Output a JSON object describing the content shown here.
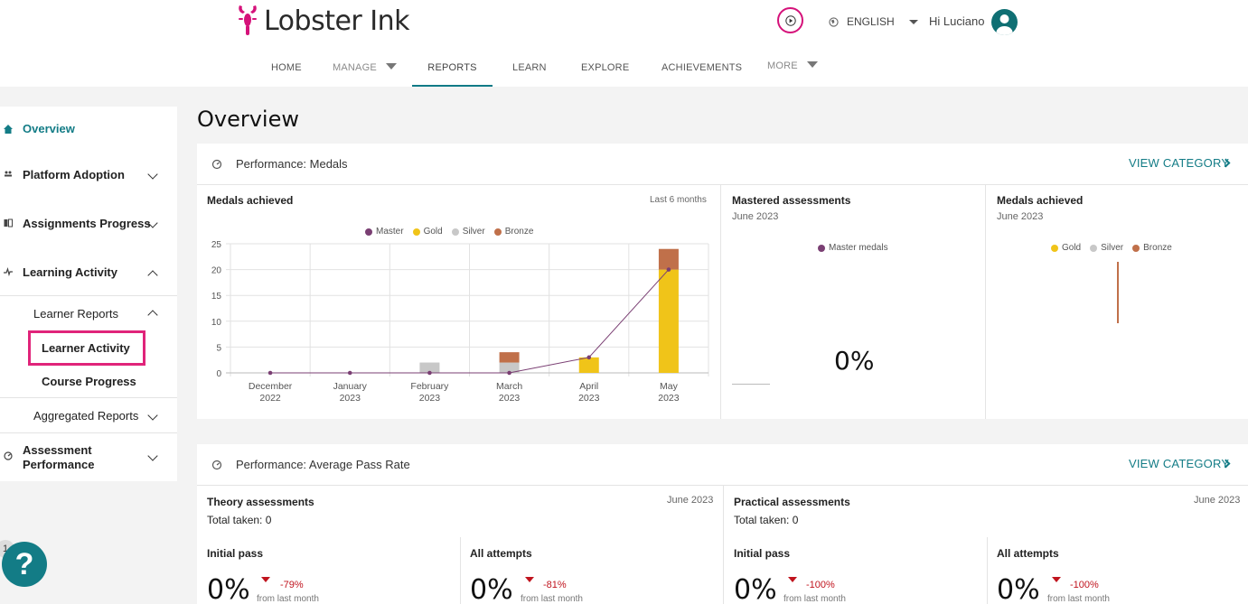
{
  "header": {
    "logo_text": "Lobster Ink",
    "language": "ENGLISH",
    "greeting": "Hi Luciano"
  },
  "nav": [
    {
      "label": "HOME"
    },
    {
      "label": "MANAGE"
    },
    {
      "label": "REPORTS"
    },
    {
      "label": "LEARN"
    },
    {
      "label": "EXPLORE"
    },
    {
      "label": "ACHIEVEMENTS"
    },
    {
      "label": "MORE"
    }
  ],
  "sidebar": {
    "items": [
      {
        "label": "Overview"
      },
      {
        "label": "Platform Adoption"
      },
      {
        "label": "Assignments Progress"
      },
      {
        "label": "Learning Activity"
      },
      {
        "label": "Learner Reports"
      },
      {
        "label": "Learner Activity"
      },
      {
        "label": "Course Progress"
      },
      {
        "label": "Aggregated Reports"
      },
      {
        "label": "Assessment"
      },
      {
        "label": "Performance"
      }
    ]
  },
  "help": {
    "label": "?",
    "badge": "1"
  },
  "page": {
    "title": "Overview"
  },
  "medals_card": {
    "title": "Performance: Medals",
    "view_category": "VIEW CATEGORY",
    "chart_panel": {
      "title": "Medals achieved",
      "range": "Last 6 months"
    },
    "mastered": {
      "title": "Mastered assessments",
      "date": "June 2023",
      "legend": "Master medals",
      "value": "0%"
    },
    "medals_june": {
      "title": "Medals achieved",
      "date": "June 2023",
      "legend": [
        "Gold",
        "Silver",
        "Bronze"
      ]
    }
  },
  "chart_data": {
    "type": "bar",
    "categories": [
      "December 2022",
      "January 2023",
      "February 2023",
      "March 2023",
      "April 2023",
      "May 2023"
    ],
    "category_lines": [
      [
        "December",
        "2022"
      ],
      [
        "January",
        "2023"
      ],
      [
        "February",
        "2023"
      ],
      [
        "March",
        "2023"
      ],
      [
        "April",
        "2023"
      ],
      [
        "May",
        "2023"
      ]
    ],
    "series": [
      {
        "name": "Master",
        "kind": "line",
        "color": "#7a3f73",
        "values": [
          0,
          0,
          0,
          0,
          3,
          20
        ]
      },
      {
        "name": "Gold",
        "kind": "bar",
        "color": "#f0c419",
        "values": [
          0,
          0,
          0,
          0,
          3,
          20
        ]
      },
      {
        "name": "Silver",
        "kind": "bar",
        "color": "#c8c8c8",
        "values": [
          0,
          0,
          2,
          2,
          0,
          0
        ]
      },
      {
        "name": "Bronze",
        "kind": "bar",
        "color": "#c0704a",
        "values": [
          0,
          0,
          0,
          2,
          0,
          4
        ]
      }
    ],
    "ylim": [
      0,
      25
    ],
    "yticks": [
      0,
      5,
      10,
      15,
      20,
      25
    ],
    "grid": true,
    "legend_position": "top"
  },
  "pass_card": {
    "title": "Performance: Average Pass Rate",
    "view_category": "VIEW CATEGORY",
    "theory": {
      "title": "Theory assessments",
      "date": "June 2023",
      "total": "Total taken: 0",
      "initial": {
        "label": "Initial pass",
        "value": "0%",
        "delta": "-79%",
        "from": "from last month"
      },
      "all": {
        "label": "All attempts",
        "value": "0%",
        "delta": "-81%",
        "from": "from last month"
      }
    },
    "practical": {
      "title": "Practical assessments",
      "date": "June 2023",
      "total": "Total taken: 0",
      "initial": {
        "label": "Initial pass",
        "value": "0%",
        "delta": "-100%",
        "from": "from last month"
      },
      "all": {
        "label": "All attempts",
        "value": "0%",
        "delta": "-100%",
        "from": "from last month"
      }
    }
  },
  "colors": {
    "accent": "#137c86",
    "brand": "#d5127a",
    "negative": "#c0141e",
    "master": "#7a3f73",
    "gold": "#f0c419",
    "silver": "#c8c8c8",
    "bronze": "#c0704a"
  }
}
